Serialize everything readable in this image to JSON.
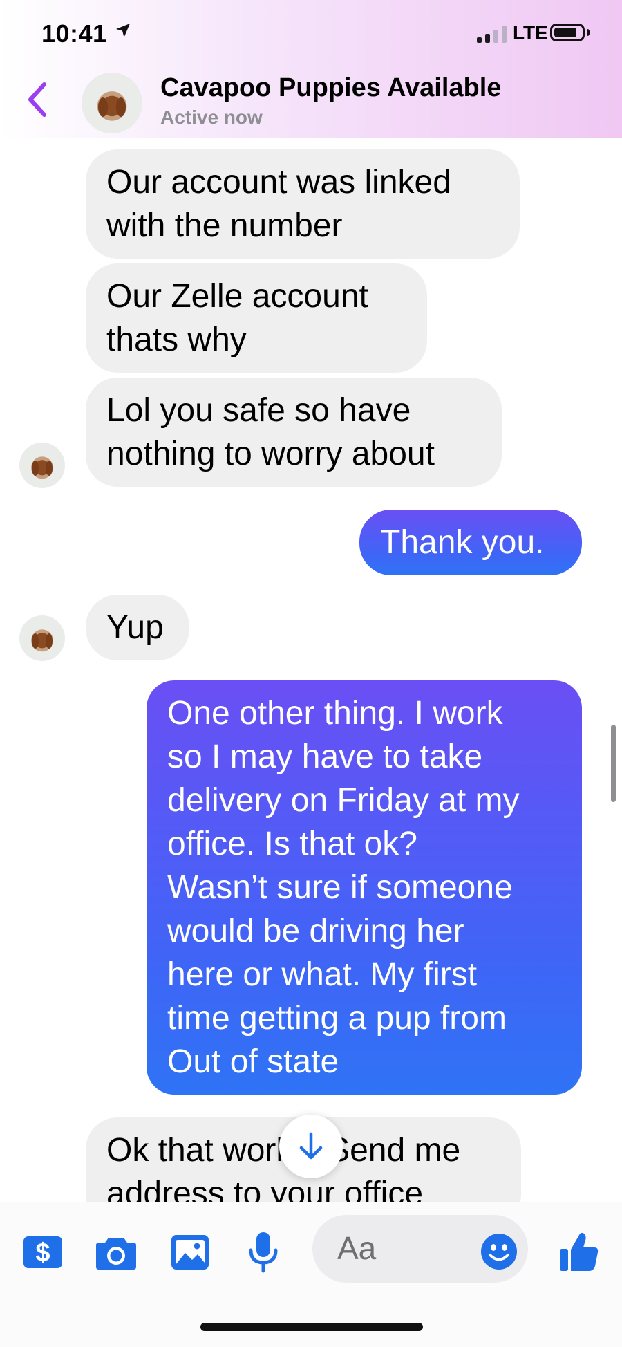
{
  "status_bar": {
    "time": "10:41",
    "network": "LTE",
    "battery_level": 0.85
  },
  "header": {
    "name": "Cavapoo Puppies Available",
    "status": "Active now",
    "avatar_icon": "puppy-avatar"
  },
  "messages": [
    {
      "from": "them",
      "text": "Our account was linked\nwith the number"
    },
    {
      "from": "them",
      "text": "Our Zelle account\nthats why"
    },
    {
      "from": "them",
      "text": "Lol you safe so have\nnothing to worry about"
    },
    {
      "from": "me",
      "text": "Thank you."
    },
    {
      "from": "them",
      "text": "Yup"
    },
    {
      "from": "me",
      "text": "One other thing. I work\nso I may have to take\ndelivery on Friday at my\noffice. Is that ok?\nWasn’t sure if someone\nwould be driving her\nhere or what. My first\ntime getting a pup from\nOut of state"
    },
    {
      "from": "them",
      "text": "Ok that works. Send me\naddress to your office"
    }
  ],
  "composer": {
    "placeholder": "Aa",
    "icons": [
      "payment-icon",
      "camera-icon",
      "photo-gallery-icon",
      "microphone-icon",
      "emoji-icon",
      "thumbs-up-icon"
    ]
  },
  "colors": {
    "accent": "#9b3df0",
    "incoming_bubble": "#efefef",
    "outgoing_top": "#6a4ff5",
    "outgoing_bottom": "#2f73f5",
    "icon_blue": "#1e6fe8"
  }
}
